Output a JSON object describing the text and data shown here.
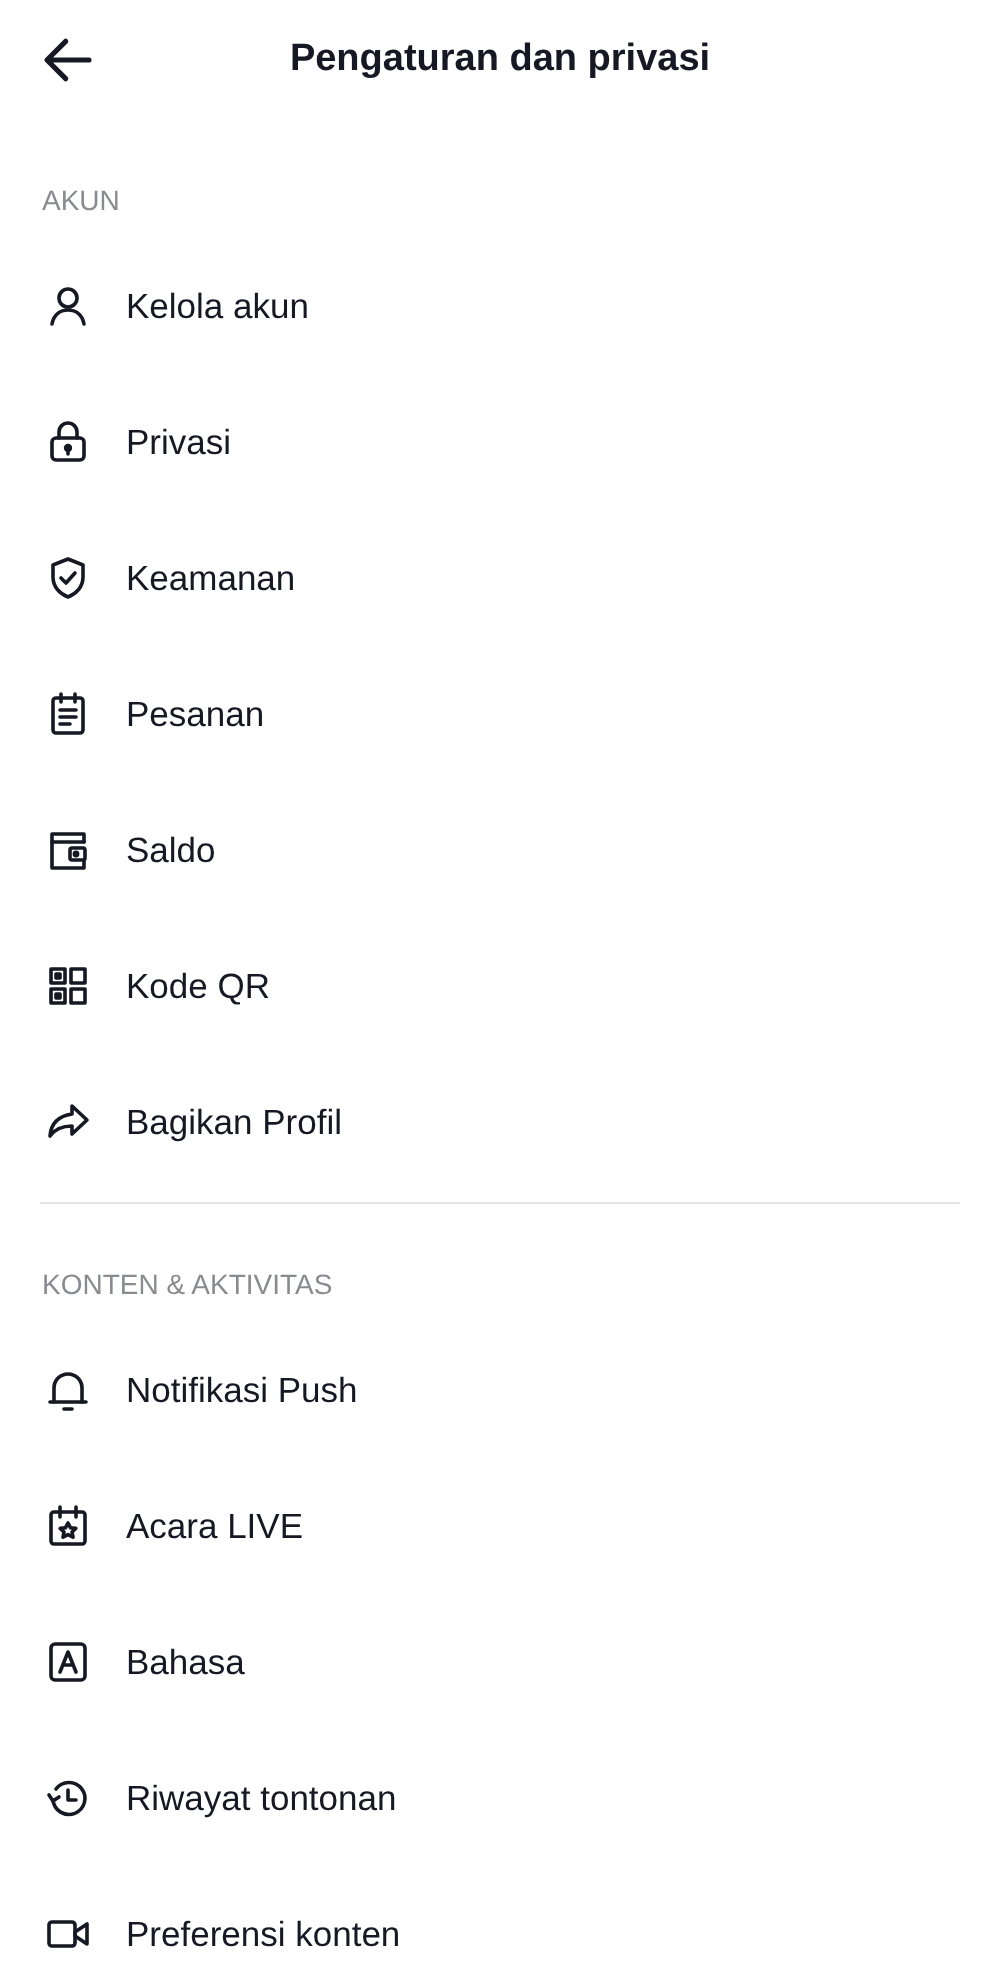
{
  "header": {
    "title": "Pengaturan dan privasi"
  },
  "sections": [
    {
      "title": "AKUN",
      "items": [
        {
          "label": "Kelola akun"
        },
        {
          "label": "Privasi"
        },
        {
          "label": "Keamanan"
        },
        {
          "label": "Pesanan"
        },
        {
          "label": "Saldo"
        },
        {
          "label": "Kode QR"
        },
        {
          "label": "Bagikan Profil"
        }
      ]
    },
    {
      "title": "KONTEN & AKTIVITAS",
      "items": [
        {
          "label": "Notifikasi Push"
        },
        {
          "label": "Acara LIVE"
        },
        {
          "label": "Bahasa"
        },
        {
          "label": "Riwayat tontonan"
        },
        {
          "label": "Preferensi konten"
        }
      ]
    }
  ]
}
